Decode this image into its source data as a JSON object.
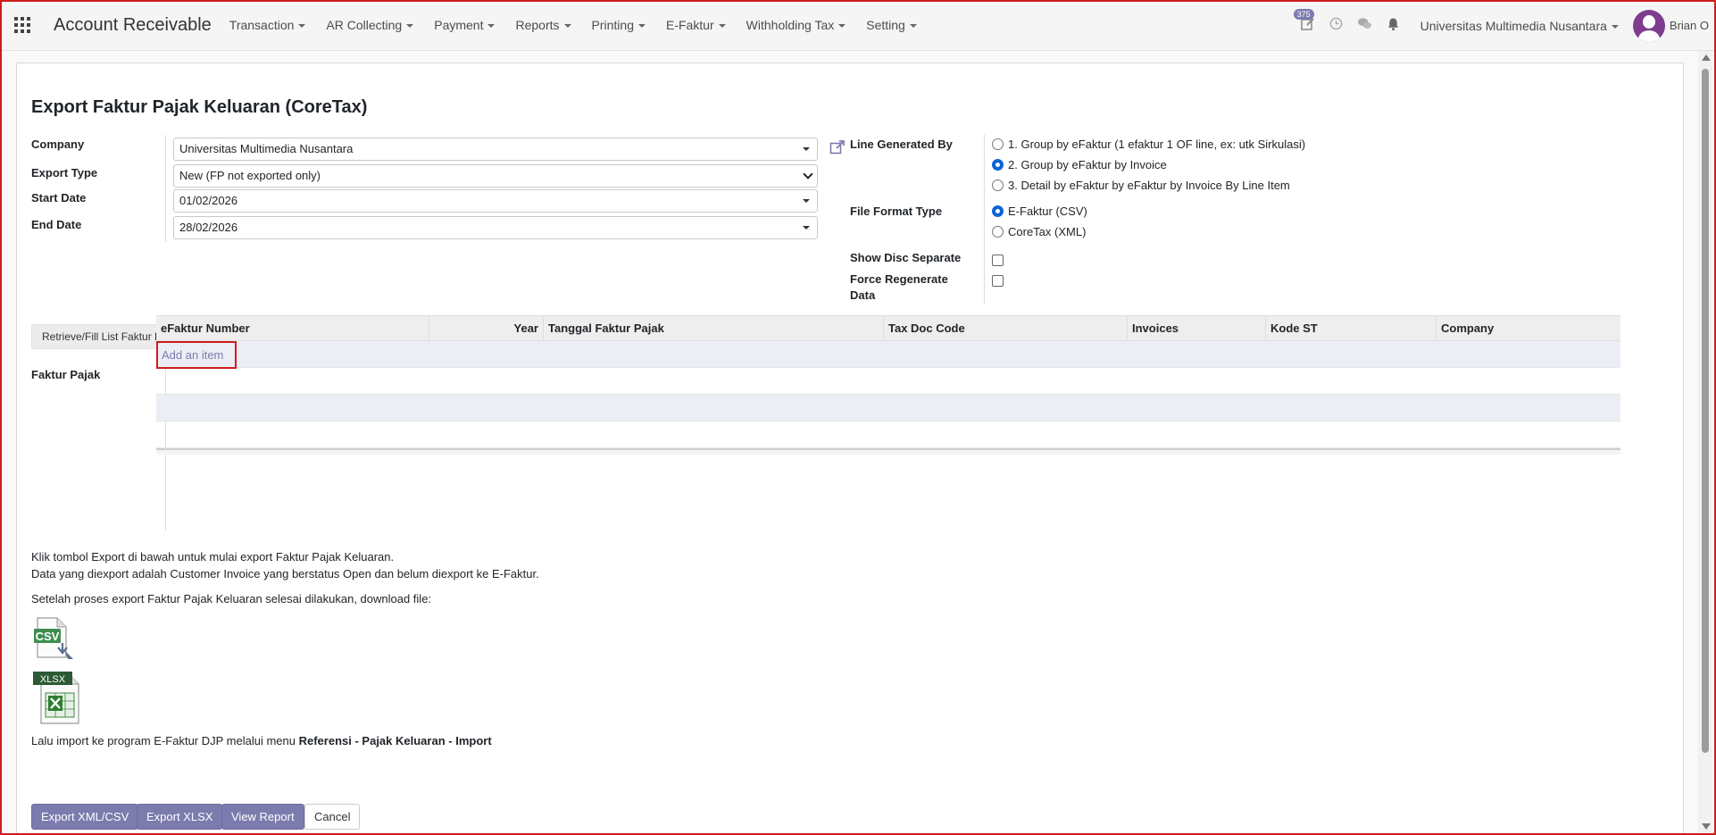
{
  "navbar": {
    "app_title": "Account Receivable",
    "menu": [
      "Transaction",
      "AR Collecting",
      "Payment",
      "Reports",
      "Printing",
      "E-Faktur",
      "Withholding Tax",
      "Setting"
    ],
    "badge_count": "375",
    "company": "Universitas Multimedia Nusantara",
    "user": "Brian O"
  },
  "form": {
    "title": "Export Faktur Pajak Keluaran (CoreTax)",
    "company_label": "Company",
    "company_value": "Universitas Multimedia Nusantara",
    "export_type_label": "Export Type",
    "export_type_value": "New (FP not exported only)",
    "start_date_label": "Start Date",
    "start_date_value": "01/02/2026",
    "end_date_label": "End Date",
    "end_date_value": "28/02/2026",
    "line_generated_label": "Line Generated By",
    "line_generated_options": [
      "1. Group by eFaktur (1 efaktur 1 OF line, ex: utk Sirkulasi)",
      "2. Group by eFaktur by Invoice",
      "3. Detail by eFaktur by eFaktur by Invoice By Line Item"
    ],
    "line_generated_selected": 1,
    "file_format_label": "File Format Type",
    "file_format_options": [
      "E-Faktur (CSV)",
      "CoreTax (XML)"
    ],
    "file_format_selected": 0,
    "show_disc_label": "Show Disc Separate",
    "show_disc_checked": false,
    "force_regen_label_line1": "Force Regenerate",
    "force_regen_label_line2": "Data",
    "force_regen_checked": false,
    "retrieve_button": "Retrieve/Fill List Faktur Pajak",
    "faktur_label": "Faktur Pajak"
  },
  "table": {
    "columns": [
      "eFaktur Number",
      "Year",
      "Tanggal Faktur Pajak",
      "Tax Doc Code",
      "Invoices",
      "Kode ST",
      "Company"
    ],
    "add_item": "Add an item"
  },
  "notes": {
    "line1": "Klik tombol Export di bawah untuk mulai export Faktur Pajak Keluaran.",
    "line2": "Data yang diexport adalah Customer Invoice yang berstatus Open dan belum diexport ke E-Faktur.",
    "line3": "Setelah proses export Faktur Pajak Keluaran selesai dilakukan, download file:",
    "csv_icon_text": "CSV",
    "xlsx_icon_text": "XLSX",
    "import_prefix": "Lalu import ke program E-Faktur DJP melalui menu ",
    "import_ref": "Referensi",
    "import_sep1": " - ",
    "import_pk": "Pajak Keluaran",
    "import_sep2": " - ",
    "import_imp": "Import"
  },
  "buttons": {
    "export_xml_csv": "Export XML/CSV",
    "export_xlsx": "Export XLSX",
    "view_report": "View Report",
    "cancel": "Cancel"
  },
  "colors": {
    "primary": "#7c7bad",
    "highlight_border": "#d01c1c",
    "radio_selected": "#0a66d6"
  }
}
